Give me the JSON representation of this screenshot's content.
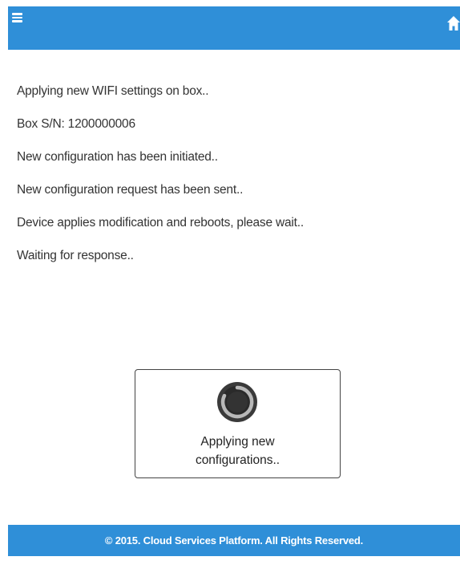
{
  "header": {
    "menu_icon": "hamburger-menu-icon",
    "home_icon": "home-icon",
    "color": "#2f8fd8"
  },
  "status": {
    "lines": [
      "Applying new WIFI settings on box..",
      "Box S/N: 1200000006",
      "New configuration has been initiated..",
      "New configuration request has been sent..",
      "Device applies modification and reboots, please wait..",
      "Waiting for response.."
    ]
  },
  "progress": {
    "line1": "Applying new",
    "line2": "configurations..",
    "icon": "spinner-icon"
  },
  "footer": {
    "text": "© 2015. Cloud Services Platform. All Rights Reserved."
  }
}
